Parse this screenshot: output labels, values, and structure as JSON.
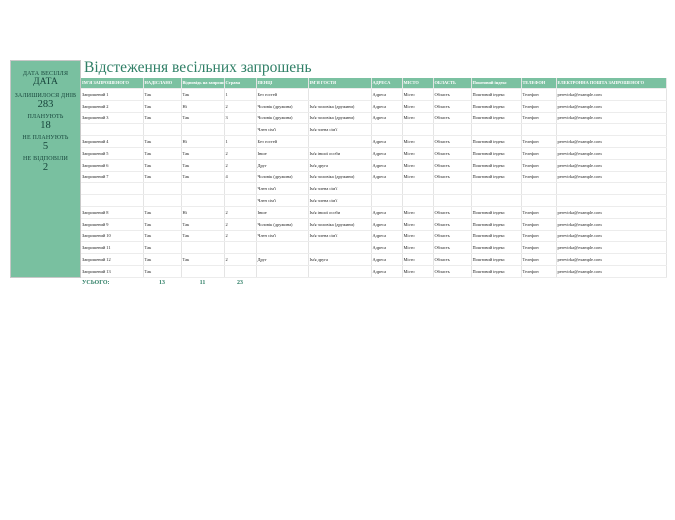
{
  "title": "Відстеження весільних запрошень",
  "summary": {
    "date_label": "ДАТА ВЕСІЛЛЯ",
    "date_value": "ДАТА",
    "days_left_label": "ЗАЛИШИЛОСЯ ДНІВ",
    "days_left_value": "283",
    "planning_label": "ПЛАНУЮТЬ",
    "planning_value": "18",
    "not_planning_label": "НЕ ПЛАНУЮТЬ",
    "not_planning_value": "5",
    "no_reply_label": "НЕ ВІДПОВІЛИ",
    "no_reply_value": "2"
  },
  "columns": [
    "ІМ'Я ЗАПРОШЕНОГО",
    "НАДІСЛАНО",
    "Відповідь на запрошення",
    "Страва",
    "ПЕНЦІ",
    "ІМ'Я ГОСТЯ",
    "АДРЕСА",
    "МІСТО",
    "ОБЛАСТЬ",
    "Поштовий індекс",
    "ТЕЛЕФОН",
    "ЕЛЕКТРОННА ПОШТА ЗАПРОШЕНОГО"
  ],
  "rows": [
    [
      "Запрошений 1",
      "Так",
      "Так",
      "1",
      "Без гостей",
      "",
      "Адреса",
      "Місто",
      "Область",
      "Поштовий індекс",
      "Телефон",
      "perevirka@example.com"
    ],
    [
      "Запрошений 2",
      "Так",
      "Ні",
      "2",
      "Чоловік (дружина)",
      "Ім'я чоловіка (дружини)",
      "Адреса",
      "Місто",
      "Область",
      "Поштовий індекс",
      "Телефон",
      "perevirka@example.com"
    ],
    [
      "Запрошений 3",
      "Так",
      "Так",
      "3",
      "Чоловік (дружина)",
      "Ім'я чоловіка (дружини)",
      "Адреса",
      "Місто",
      "Область",
      "Поштовий індекс",
      "Телефон",
      "perevirka@example.com"
    ],
    [
      "",
      "",
      "",
      "",
      "Член сім'ї",
      "Ім'я члена сім'ї",
      "",
      "",
      "",
      "",
      "",
      ""
    ],
    [
      "Запрошений 4",
      "Так",
      "Ні",
      "1",
      "Без гостей",
      "",
      "Адреса",
      "Місто",
      "Область",
      "Поштовий індекс",
      "Телефон",
      "perevirka@example.com"
    ],
    [
      "Запрошений 5",
      "Так",
      "Так",
      "2",
      "Інше",
      "Ім'я іншої особи",
      "Адреса",
      "Місто",
      "Область",
      "Поштовий індекс",
      "Телефон",
      "perevirka@example.com"
    ],
    [
      "Запрошений 6",
      "Так",
      "Так",
      "2",
      "Друг",
      "Ім'я друга",
      "Адреса",
      "Місто",
      "Область",
      "Поштовий індекс",
      "Телефон",
      "perevirka@example.com"
    ],
    [
      "Запрошений 7",
      "Так",
      "Так",
      "4",
      "Чоловік (дружина)",
      "Ім'я чоловіка (дружини)",
      "Адреса",
      "Місто",
      "Область",
      "Поштовий індекс",
      "Телефон",
      "perevirka@example.com"
    ],
    [
      "",
      "",
      "",
      "",
      "Член сім'ї",
      "Ім'я члена сім'ї",
      "",
      "",
      "",
      "",
      "",
      ""
    ],
    [
      "",
      "",
      "",
      "",
      "Член сім'ї",
      "Ім'я члена сім'ї",
      "",
      "",
      "",
      "",
      "",
      ""
    ],
    [
      "Запрошений 8",
      "Так",
      "Ні",
      "2",
      "Інше",
      "Ім'я іншої особи",
      "Адреса",
      "Місто",
      "Область",
      "Поштовий індекс",
      "Телефон",
      "perevirka@example.com"
    ],
    [
      "Запрошений 9",
      "Так",
      "Так",
      "2",
      "Чоловік (дружина)",
      "Ім'я чоловіка (дружини)",
      "Адреса",
      "Місто",
      "Область",
      "Поштовий індекс",
      "Телефон",
      "perevirka@example.com"
    ],
    [
      "Запрошений 10",
      "Так",
      "Так",
      "2",
      "Член сім'ї",
      "Ім'я члена сім'ї",
      "Адреса",
      "Місто",
      "Область",
      "Поштовий індекс",
      "Телефон",
      "perevirka@example.com"
    ],
    [
      "Запрошений 11",
      "Так",
      "",
      "",
      "",
      "",
      "Адреса",
      "Місто",
      "Область",
      "Поштовий індекс",
      "Телефон",
      "perevirka@example.com"
    ],
    [
      "Запрошений 12",
      "Так",
      "Так",
      "2",
      "Друг",
      "Ім'я друга",
      "Адреса",
      "Місто",
      "Область",
      "Поштовий індекс",
      "Телефон",
      "perevirka@example.com"
    ],
    [
      "Запрошений 13",
      "Так",
      "",
      "",
      "",
      "",
      "Адреса",
      "Місто",
      "Область",
      "Поштовий індекс",
      "Телефон",
      "perevirka@example.com"
    ]
  ],
  "totals": {
    "label": "УСЬОГО:",
    "sent": "13",
    "replied": "11",
    "meals": "23"
  }
}
